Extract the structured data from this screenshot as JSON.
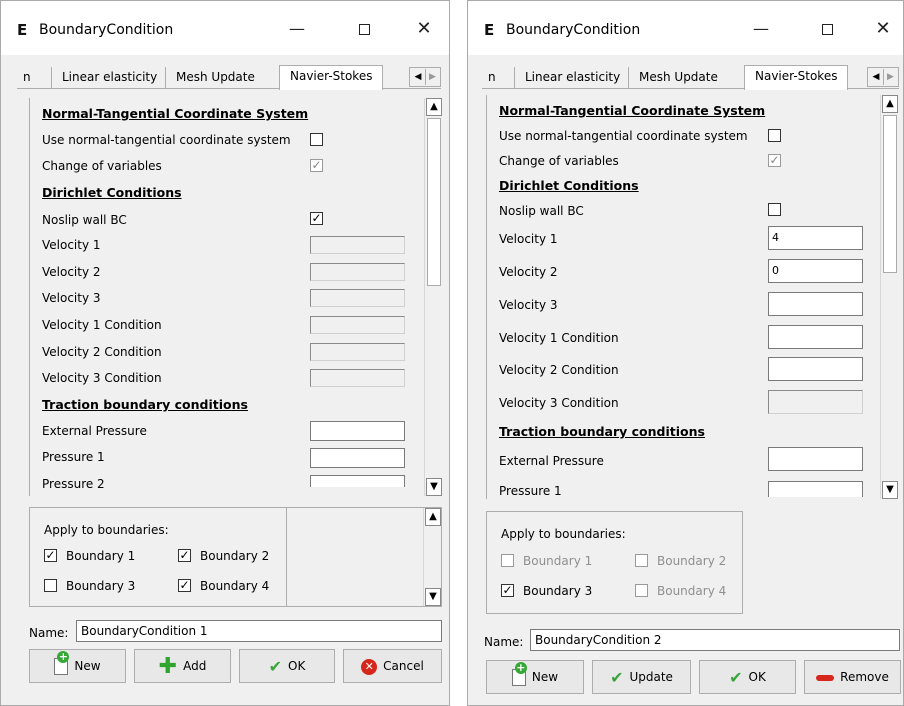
{
  "windows": [
    {
      "title": "BoundaryCondition",
      "app_icon": "E",
      "tabs": [
        "n",
        "Linear elasticity",
        "Mesh Update",
        "Navier-Stokes"
      ],
      "active_tab": "Navier-Stokes",
      "form": {
        "ntcs_heading": "Normal-Tangential Coordinate System",
        "use_ntcs_label": "Use normal-tangential coordinate system",
        "use_ntcs_checked": false,
        "change_vars_label": "Change of variables",
        "change_vars_checked": true,
        "dirichlet_heading": "Dirichlet Conditions",
        "noslip_label": "Noslip wall BC",
        "noslip_checked": true,
        "velocity1_label": "Velocity 1",
        "velocity1_value": "",
        "velocity2_label": "Velocity 2",
        "velocity2_value": "",
        "velocity3_label": "Velocity 3",
        "velocity3_value": "",
        "v1cond_label": "Velocity 1 Condition",
        "v1cond_value": "",
        "v2cond_label": "Velocity 2 Condition",
        "v2cond_value": "",
        "v3cond_label": "Velocity 3 Condition",
        "v3cond_value": "",
        "traction_heading": "Traction boundary conditions",
        "ext_pressure_label": "External Pressure",
        "ext_pressure_value": "",
        "pressure1_label": "Pressure 1",
        "pressure1_value": "",
        "pressure2_label": "Pressure 2",
        "pressure2_value": ""
      },
      "boundaries": {
        "label": "Apply to boundaries:",
        "items": [
          {
            "label": "Boundary 1",
            "checked": true,
            "enabled": true
          },
          {
            "label": "Boundary 2",
            "checked": true,
            "enabled": true
          },
          {
            "label": "Boundary 3",
            "checked": false,
            "enabled": true
          },
          {
            "label": "Boundary 4",
            "checked": true,
            "enabled": true
          }
        ]
      },
      "name_label": "Name:",
      "name_value": "BoundaryCondition 1",
      "buttons": [
        "New",
        "Add",
        "OK",
        "Cancel"
      ]
    },
    {
      "title": "BoundaryCondition",
      "app_icon": "E",
      "tabs": [
        "n",
        "Linear elasticity",
        "Mesh Update",
        "Navier-Stokes"
      ],
      "active_tab": "Navier-Stokes",
      "form": {
        "ntcs_heading": "Normal-Tangential Coordinate System",
        "use_ntcs_label": "Use normal-tangential coordinate system",
        "use_ntcs_checked": false,
        "change_vars_label": "Change of variables",
        "change_vars_checked": true,
        "dirichlet_heading": "Dirichlet Conditions",
        "noslip_label": "Noslip wall BC",
        "noslip_checked": false,
        "velocity1_label": "Velocity 1",
        "velocity1_value": "4",
        "velocity2_label": "Velocity 2",
        "velocity2_value": "0",
        "velocity3_label": "Velocity 3",
        "velocity3_value": "",
        "v1cond_label": "Velocity 1 Condition",
        "v1cond_value": "",
        "v2cond_label": "Velocity 2 Condition",
        "v2cond_value": "",
        "v3cond_label": "Velocity 3 Condition",
        "v3cond_value": "",
        "traction_heading": "Traction boundary conditions",
        "ext_pressure_label": "External Pressure",
        "ext_pressure_value": "",
        "pressure1_label": "Pressure 1",
        "pressure1_value": ""
      },
      "boundaries": {
        "label": "Apply to boundaries:",
        "items": [
          {
            "label": "Boundary 1",
            "checked": false,
            "enabled": false
          },
          {
            "label": "Boundary 2",
            "checked": false,
            "enabled": false
          },
          {
            "label": "Boundary 3",
            "checked": true,
            "enabled": true
          },
          {
            "label": "Boundary 4",
            "checked": false,
            "enabled": false
          }
        ]
      },
      "name_label": "Name:",
      "name_value": "BoundaryCondition 2",
      "buttons": [
        "New",
        "Update",
        "OK",
        "Remove"
      ]
    }
  ],
  "titlebar_buttons": {
    "minimize": "—",
    "close": "✕"
  }
}
